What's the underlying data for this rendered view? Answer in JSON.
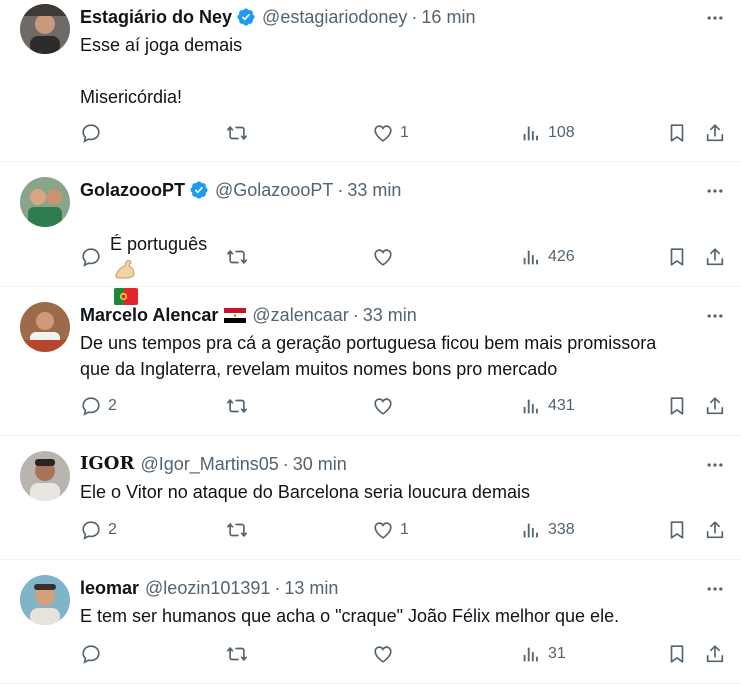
{
  "tweets": [
    {
      "name": "Estagiário do Ney",
      "verified": true,
      "handle": "@estagiariodoney",
      "dot": "·",
      "time": "16 min",
      "text": "Esse aí joga demais\n\nMisericórdia!",
      "replies": "",
      "retweets": "",
      "likes": "1",
      "views": "108"
    },
    {
      "name": "GolazoooPT",
      "verified": true,
      "handle": "@GolazoooPT",
      "dot": "·",
      "time": "33 min",
      "text": "É português",
      "emojis": [
        "flexed-biceps",
        "portugal-flag"
      ],
      "replies": "",
      "retweets": "",
      "likes": "",
      "views": "426"
    },
    {
      "name": "Marcelo Alencar",
      "flag": "egypt-flag",
      "handle": "@zalencaar",
      "dot": "·",
      "time": "33 min",
      "text": "De uns tempos pra cá a geração portuguesa ficou bem mais promissora\nque da Inglaterra, revelam muitos nomes bons pro mercado",
      "replies": "2",
      "retweets": "",
      "likes": "",
      "views": "431"
    },
    {
      "name": "IGOR",
      "handle": "@Igor_Martins05",
      "dot": "·",
      "time": "30 min",
      "text": "Ele o Vitor no ataque do Barcelona seria loucura demais",
      "replies": "2",
      "retweets": "",
      "likes": "1",
      "views": "338"
    },
    {
      "name": "leomar",
      "handle": "@leozin101391",
      "dot": "·",
      "time": "13 min",
      "text": "E tem ser humanos que acha o \"craque\" João Félix melhor que ele.",
      "replies": "",
      "retweets": "",
      "likes": "",
      "views": "31"
    }
  ],
  "colors": {
    "text": "#0f1419",
    "secondary": "#536471",
    "verified": "#1d9bf0",
    "divider": "#eff3f4"
  },
  "icons": [
    "reply-icon",
    "retweet-icon",
    "like-icon",
    "views-icon",
    "bookmark-icon",
    "share-icon",
    "more-icon",
    "verified-icon"
  ]
}
